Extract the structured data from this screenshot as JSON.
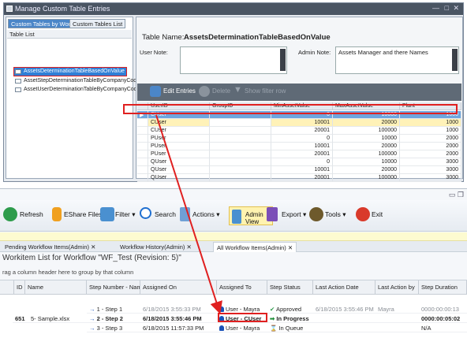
{
  "top_window": {
    "title": "Manage Custom Table Entries",
    "left_tabs": [
      "Custom Tables by Workflow",
      "Custom Tables List"
    ],
    "table_list_header": "Table List",
    "table_list": [
      "AssetsDeterminationTableBasedOnValue",
      "AssetStepDeterminationTableByCompanyCode",
      "AssetUserDeterminationTableByCompanyCode"
    ],
    "table_name_label": "Table Name:",
    "table_name_value": "AssetsDeterminationTableBasedOnValue",
    "user_note_label": "User Note:",
    "admin_note_label": "Admin Note:",
    "admin_note_value": "Assets Manager and there Names",
    "toolbar": {
      "edit_entries": "Edit Entries",
      "delete": "Delete",
      "show_filter_row": "Show filter row"
    },
    "grid": {
      "columns": [
        "UserID",
        "GroupID",
        "MinAssetValue",
        "MaxAssetValue",
        "Plant"
      ],
      "rows": [
        [
          "CUser",
          "",
          "0",
          "10000",
          "1000"
        ],
        [
          "CUser",
          "",
          "10001",
          "20000",
          "1000"
        ],
        [
          "CUser",
          "",
          "20001",
          "100000",
          "1000"
        ],
        [
          "PUser",
          "",
          "0",
          "10000",
          "2000"
        ],
        [
          "PUser",
          "",
          "10001",
          "20000",
          "2000"
        ],
        [
          "PUser",
          "",
          "20001",
          "100000",
          "2000"
        ],
        [
          "QUser",
          "",
          "0",
          "10000",
          "3000"
        ],
        [
          "QUser",
          "",
          "10001",
          "20000",
          "3000"
        ],
        [
          "QUser",
          "",
          "20001",
          "100000",
          "3000"
        ]
      ]
    }
  },
  "bottom_window": {
    "ribbon": {
      "refresh": "Refresh",
      "eshare": "EShare Files",
      "filter": "Filter",
      "search": "Search",
      "actions": "Actions",
      "admin_view": "Admin View",
      "export": "Export",
      "tools": "Tools",
      "exit": "Exit"
    },
    "tabs": [
      "Pending Workflow Items(Admin)",
      "Workflow History(Admin)",
      "All Workflow Items(Admin)"
    ],
    "worklist_title": "Workitem List for Workflow \"WF_Test (Revision: 5)\"",
    "group_hint": "rag a column header here to group by that column",
    "columns": [
      "ID",
      "Name",
      "Step Number - Name",
      "Assigned On",
      "Assigned To",
      "Step Status",
      "Last Action Date",
      "Last Action by",
      "Step Duration"
    ],
    "id": "651",
    "name": "5- Sample.xlsx",
    "rows": [
      {
        "step": "1 - Step 1",
        "assigned_on": "6/18/2015 3:55:33 PM",
        "assigned_to": "User - Mayra",
        "status": "Approved",
        "last_action_date": "6/18/2015 3:55:46 PM",
        "last_action_by": "Mayra",
        "duration": "0000:00:00:13"
      },
      {
        "step": "2 - Step 2",
        "assigned_on": "6/18/2015 3:55:46 PM",
        "assigned_to": "User - CUser",
        "status": "In Progress",
        "last_action_date": "",
        "last_action_by": "",
        "duration": "0000:00:05:02"
      },
      {
        "step": "3 - Step 3",
        "assigned_on": "6/18/2015 11:57:33 PM",
        "assigned_to": "User - Mayra",
        "status": "In Queue",
        "last_action_date": "",
        "last_action_by": "",
        "duration": "N/A"
      }
    ]
  },
  "colors": {
    "highlight_red": "#e02020",
    "selection_blue": "#2f7fd6",
    "admin_view_yellow": "#fff3b0"
  }
}
